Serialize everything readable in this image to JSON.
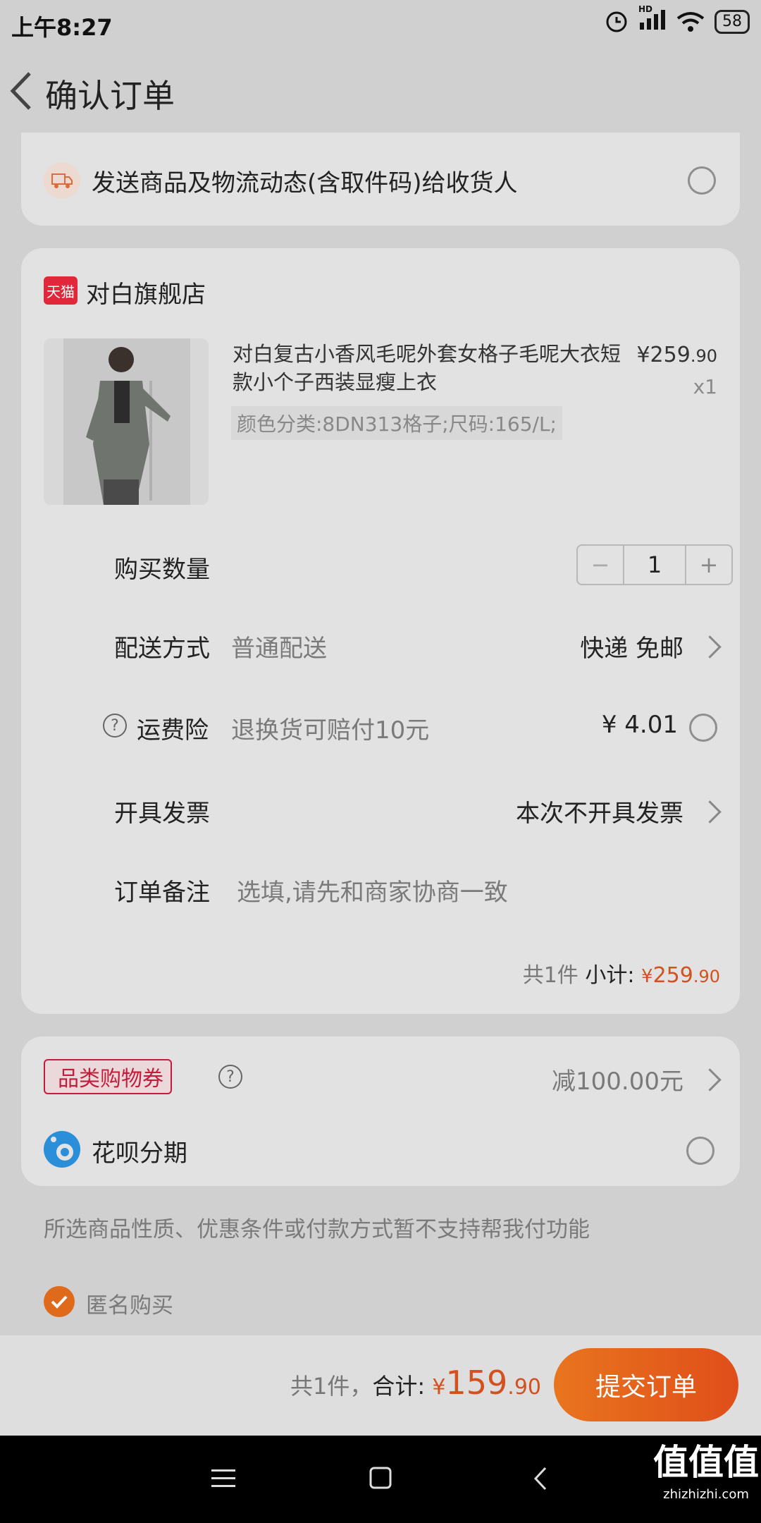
{
  "status": {
    "time": "上午8:27",
    "hd": "HD",
    "battery": "58"
  },
  "nav": {
    "title": "确认订单"
  },
  "notify": {
    "label": "发送商品及物流动态(含取件码)给收货人"
  },
  "store": {
    "badge": "天猫",
    "name": "对白旗舰店",
    "product": {
      "title": "对白复古小香风毛呢外套女格子毛呢大衣短款小个子西装显瘦上衣",
      "sku": "颜色分类:8DN313格子;尺码:165/L;",
      "price_main": "¥259",
      "price_decimal": ".90",
      "qty": "x1"
    },
    "quantity": {
      "label": "购买数量",
      "minus": "−",
      "value": "1",
      "plus": "+"
    },
    "delivery": {
      "label": "配送方式",
      "value": "普通配送",
      "right": "快递 免邮"
    },
    "insurance": {
      "label": "运费险",
      "desc": "退换货可赔付10元",
      "price": "¥ 4.01"
    },
    "invoice": {
      "label": "开具发票",
      "value": "本次不开具发票"
    },
    "note": {
      "label": "订单备注",
      "placeholder": "选填,请先和商家协商一致"
    },
    "subtotal": {
      "count": "共1件",
      "label": "小计:",
      "yen": "¥",
      "amount": "259",
      "decimal": ".90"
    }
  },
  "coupon": {
    "tag": "品类购物券",
    "value": "减100.00元"
  },
  "huabei": {
    "label": "花呗分期"
  },
  "notice": "所选商品性质、优惠条件或付款方式暂不支持帮我付功能",
  "anonymous": {
    "label": "匿名购买"
  },
  "bottom": {
    "count": "共1件，",
    "label": "合计:",
    "yen": "¥",
    "amount": "159",
    "decimal": ".90",
    "submit": "提交订单"
  },
  "colors": {
    "accent": "#e8751e",
    "price": "#d3511f",
    "tmall": "#e0283a"
  },
  "watermark": {
    "title": "值值值",
    "url": "zhizhizhi.com"
  }
}
